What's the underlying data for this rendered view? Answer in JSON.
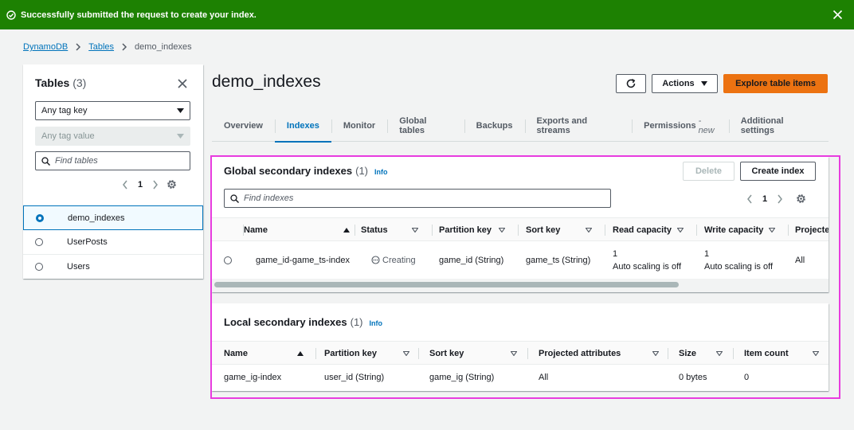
{
  "flash": {
    "message": "Successfully submitted the request to create your index.",
    "icon": "success-check-icon"
  },
  "breadcrumb": {
    "items": [
      "DynamoDB",
      "Tables"
    ],
    "current": "demo_indexes"
  },
  "left_panel": {
    "title": "Tables",
    "count": "(3)",
    "tag_key_placeholder": "Any tag key",
    "tag_value_placeholder": "Any tag value",
    "find_placeholder": "Find tables",
    "page": "1",
    "tables": [
      "demo_indexes",
      "UserPosts",
      "Users"
    ],
    "selected": "demo_indexes"
  },
  "header": {
    "title": "demo_indexes",
    "actions_label": "Actions",
    "explore_label": "Explore table items"
  },
  "tabs": [
    {
      "label": "Overview"
    },
    {
      "label": "Indexes",
      "active": true
    },
    {
      "label": "Monitor"
    },
    {
      "label": "Global tables"
    },
    {
      "label": "Backups"
    },
    {
      "label": "Exports and streams"
    },
    {
      "label": "Permissions",
      "suffix": "- new"
    },
    {
      "label": "Additional settings"
    }
  ],
  "gsi": {
    "title": "Global secondary indexes",
    "count": "(1)",
    "info": "Info",
    "delete_label": "Delete",
    "create_label": "Create index",
    "find_placeholder": "Find indexes",
    "page": "1",
    "columns": [
      "Name",
      "Status",
      "Partition key",
      "Sort key",
      "Read capacity",
      "Write capacity",
      "Projecte"
    ],
    "rows": [
      {
        "name": "game_id-game_ts-index",
        "status": "Creating",
        "partition_key": "game_id (String)",
        "sort_key": "game_ts (String)",
        "read_capacity": "1",
        "read_scaling": "Auto scaling is off",
        "write_capacity": "1",
        "write_scaling": "Auto scaling is off",
        "projected": "All"
      }
    ]
  },
  "lsi": {
    "title": "Local secondary indexes",
    "count": "(1)",
    "info": "Info",
    "columns": [
      "Name",
      "Partition key",
      "Sort key",
      "Projected attributes",
      "Size",
      "Item count"
    ],
    "rows": [
      {
        "name": "game_ig-index",
        "partition_key": "user_id (String)",
        "sort_key": "game_ig (String)",
        "projected": "All",
        "size": "0 bytes",
        "item_count": "0"
      }
    ]
  },
  "colors": {
    "success": "#1d8102",
    "link": "#0073bb",
    "primary": "#ec7211",
    "highlight": "#e83cdf"
  }
}
